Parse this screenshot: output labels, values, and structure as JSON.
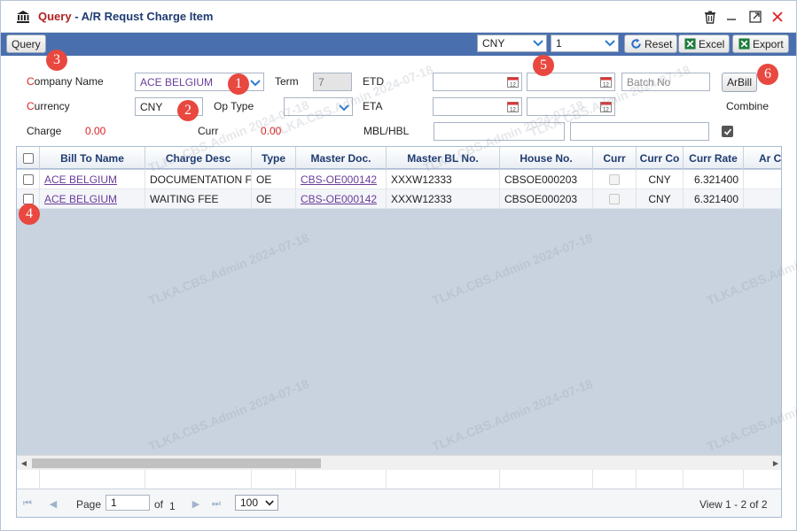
{
  "window": {
    "title_prefix": "Query",
    "title_sep": " - ",
    "title_main": "A/R Requst Charge Item"
  },
  "toolbar": {
    "query_label": "Query",
    "currency_select": "CNY",
    "rate_select": "1",
    "reset_label": "Reset",
    "excel_label": "Excel",
    "export_label": "Export"
  },
  "form": {
    "company_name_label_first": "C",
    "company_name_label_rest": "ompany Name",
    "company_name_value": "ACE BELGIUM",
    "term_label": "Term",
    "term_value": "7",
    "etd_label": "ETD",
    "batch_no_placeholder": "Batch No",
    "arbill_label": "ArBill",
    "currency_label_first": "C",
    "currency_label_rest": "urrency",
    "currency_value": "CNY",
    "op_type_label": "Op Type",
    "op_type_value": "",
    "eta_label": "ETA",
    "combine_label": "Combine",
    "charge_label": "Charge",
    "charge_value": "0.00",
    "curr_label": "Curr",
    "curr_value": "0.00",
    "mbl_hbl_label": "MBL/HBL"
  },
  "grid": {
    "columns": [
      "Bill To Name",
      "Charge Desc",
      "Type",
      "Master Doc.",
      "Master BL No.",
      "House No.",
      "Curr",
      "Curr Co",
      "Curr Rate",
      "Ar C"
    ],
    "rows": [
      {
        "bill_to": "ACE BELGIUM",
        "charge_desc": "DOCUMENTATION F",
        "type": "OE",
        "master_doc": "CBS-OE000142",
        "master_bl": "XXXW12333",
        "house_no": "CBSOE000203",
        "curr_co": "CNY",
        "curr_rate": "6.321400"
      },
      {
        "bill_to": "ACE BELGIUM",
        "charge_desc": "WAITING FEE",
        "type": "OE",
        "master_doc": "CBS-OE000142",
        "master_bl": "XXXW12333",
        "house_no": "CBSOE000203",
        "curr_co": "CNY",
        "curr_rate": "6.321400"
      }
    ]
  },
  "pager": {
    "page_label": "Page",
    "page_value": "1",
    "of_label": "of",
    "total_pages": "1",
    "page_size": "100",
    "view_text": "View 1 - 2 of 2"
  },
  "badges": [
    "1",
    "2",
    "3",
    "4",
    "5",
    "6"
  ],
  "watermark": "TLKA.CBS.Admin 2024-07-18",
  "colors": {
    "toolbar_bg": "#4a6fae",
    "title_red": "#b22222",
    "title_navy": "#1f3b70",
    "badge": "#e8483f",
    "required": "#dd2222",
    "link": "#6a3d9a"
  }
}
